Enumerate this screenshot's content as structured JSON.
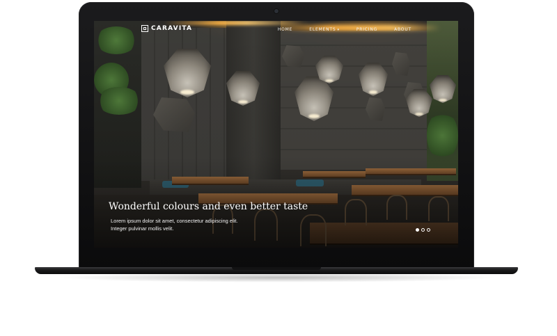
{
  "site": {
    "brand": "CARAVITA",
    "nav": [
      {
        "label": "HOME"
      },
      {
        "label": "ELEMENTS",
        "has_dropdown": true
      },
      {
        "label": "PRICING"
      },
      {
        "label": "ABOUT"
      }
    ],
    "hero": {
      "title": "Wonderful colours and even better taste",
      "line1": "Lorem ipsum dolor sit amet, consectetur adipiscing elit.",
      "line2": "Integer pulvinar mollis velit."
    },
    "slider": {
      "count": 3,
      "active": 1
    }
  },
  "icons": {
    "brand": "logo-square-icon",
    "dropdown": "caret-down-icon"
  },
  "colors": {
    "text": "#ffffff",
    "accent_light": "#ffb545",
    "device": "#0b0b0c"
  }
}
